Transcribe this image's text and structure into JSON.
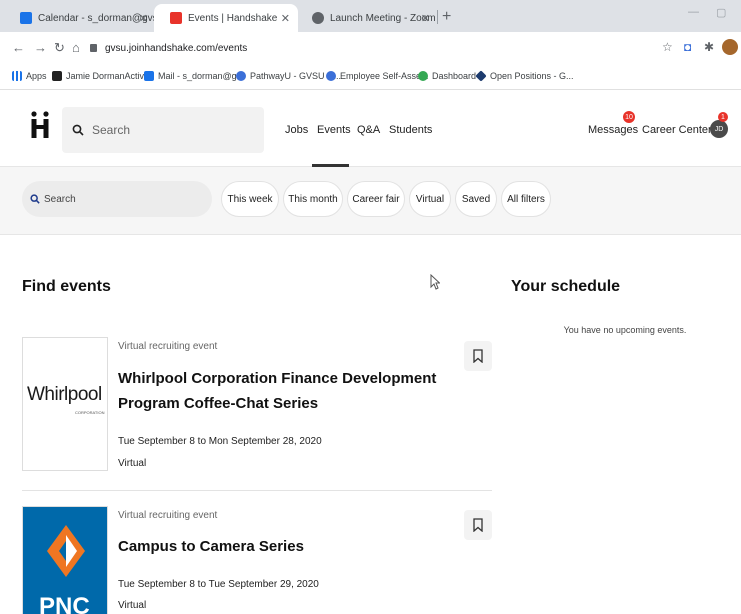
{
  "browser": {
    "tabs": [
      {
        "title": "Calendar - s_dorman@gvsu.edu",
        "favicon_color": "#1a73e8"
      },
      {
        "title": "Events | Handshake",
        "favicon_color": "#e8332a"
      },
      {
        "title": "Launch Meeting - Zoom",
        "favicon_color": "#5f6368"
      }
    ],
    "url": "gvsu.joinhandshake.com/events",
    "bookmarks": [
      {
        "label": "Apps",
        "icon": "apps-grid-icon"
      },
      {
        "label": "Jamie DormanActivi...",
        "icon": "bb-icon"
      },
      {
        "label": "Mail - s_dorman@g...",
        "icon": "mail-icon"
      },
      {
        "label": "PathwayU - GVSU C...",
        "icon": "pathway-icon"
      },
      {
        "label": "Employee Self-Asse...",
        "icon": "gvsu-icon"
      },
      {
        "label": "Dashboard",
        "icon": "dashboard-icon"
      },
      {
        "label": "Open Positions - G...",
        "icon": "diamond-icon"
      }
    ]
  },
  "header": {
    "search_placeholder": "Search",
    "nav": [
      "Jobs",
      "Events",
      "Q&A",
      "Students"
    ],
    "active_nav": "Events",
    "messages_label": "Messages",
    "messages_count": "10",
    "career_center_label": "Career Center",
    "career_center_count": "1",
    "avatar_initials": "JD"
  },
  "filters": {
    "search_placeholder": "Search",
    "chips": [
      "This week",
      "This month",
      "Career fair",
      "Virtual",
      "Saved",
      "All filters"
    ]
  },
  "main": {
    "find_events_title": "Find events",
    "events": [
      {
        "type": "Virtual recruiting event",
        "title_line1": "Whirlpool Corporation Finance Development",
        "title_line2": "Program Coffee-Chat Series",
        "dates": "Tue September 8 to Mon September 28, 2020",
        "location": "Virtual",
        "logo_text": "Whirlpool",
        "logo_subtext": "CORPORATION"
      },
      {
        "type": "Virtual recruiting event",
        "title_line1": "Campus to Camera Series",
        "dates": "Tue September 8 to Tue September 29, 2020",
        "location": "Virtual",
        "logo_text": "PNC"
      }
    ]
  },
  "schedule": {
    "title": "Your schedule",
    "empty_text": "You have no upcoming events."
  },
  "colors": {
    "accent_red": "#e8332a",
    "pnc_blue": "#0069aa",
    "pnc_orange": "#ef7622"
  }
}
